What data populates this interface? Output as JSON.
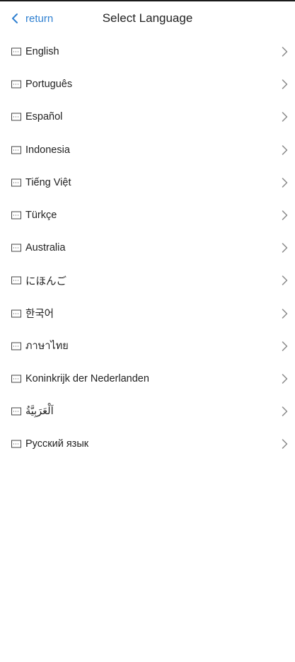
{
  "header": {
    "back_label": "return",
    "title": "Select Language"
  },
  "languages": [
    {
      "label": "English"
    },
    {
      "label": "Português"
    },
    {
      "label": "Español"
    },
    {
      "label": "Indonesia"
    },
    {
      "label": "Tiếng Việt"
    },
    {
      "label": "Türkçe"
    },
    {
      "label": "Australia"
    },
    {
      "label": "にほんご"
    },
    {
      "label": "한국어"
    },
    {
      "label": "ภาษาไทย"
    },
    {
      "label": "Koninkrijk der Nederlanden"
    },
    {
      "label": "اَلْعَرَبِيَّةُ"
    },
    {
      "label": "Русский язык"
    }
  ],
  "colors": {
    "accent": "#2f80d1",
    "text": "#222222",
    "chevron": "#8a8a8a",
    "icon": "#444444"
  }
}
